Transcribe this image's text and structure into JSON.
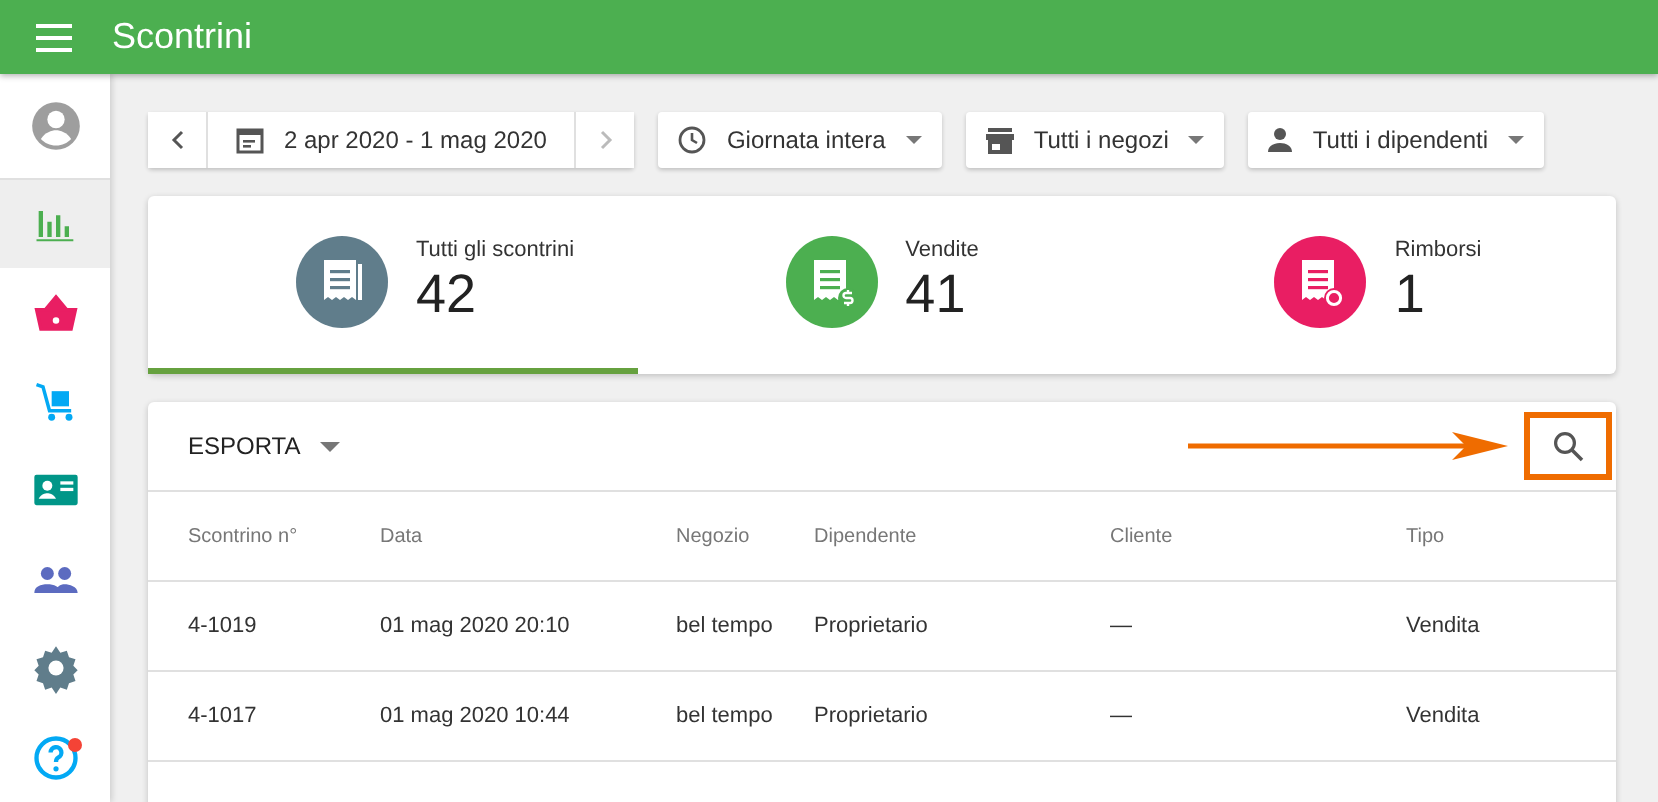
{
  "app_bar": {
    "title": "Scontrini"
  },
  "sidebar": {
    "items": [
      {
        "kind": "profile",
        "selected": false,
        "badge": false
      },
      {
        "kind": "reports",
        "selected": true,
        "badge": false
      },
      {
        "kind": "basket",
        "selected": false,
        "badge": false
      },
      {
        "kind": "cart",
        "selected": false,
        "badge": false
      },
      {
        "kind": "card",
        "selected": false,
        "badge": false
      },
      {
        "kind": "people",
        "selected": false,
        "badge": false
      },
      {
        "kind": "settings",
        "selected": false,
        "badge": false
      },
      {
        "kind": "help",
        "selected": false,
        "badge": true
      }
    ]
  },
  "filters": {
    "date_range": "2 apr 2020 - 1 mag 2020",
    "next_disabled": true,
    "time": "Giornata intera",
    "stores": "Tutti i negozi",
    "employees": "Tutti i dipendenti"
  },
  "summary": [
    {
      "kind": "all",
      "label": "Tutti gli scontrini",
      "value": "42",
      "selected": true
    },
    {
      "kind": "sales",
      "label": "Vendite",
      "value": "41",
      "selected": false
    },
    {
      "kind": "refunds",
      "label": "Rimborsi",
      "value": "1",
      "selected": false
    }
  ],
  "table": {
    "export": "ESPORTA",
    "highlight_search": true,
    "columns": [
      "Scontrino n°",
      "Data",
      "Negozio",
      "Dipendente",
      "Cliente",
      "Tipo"
    ],
    "rows": [
      [
        "4-1019",
        "01 mag 2020 20:10",
        "bel tempo",
        "Proprietario",
        "—",
        "Vendita"
      ],
      [
        "4-1017",
        "01 mag 2020 10:44",
        "bel tempo",
        "Proprietario",
        "—",
        "Vendita"
      ]
    ]
  }
}
